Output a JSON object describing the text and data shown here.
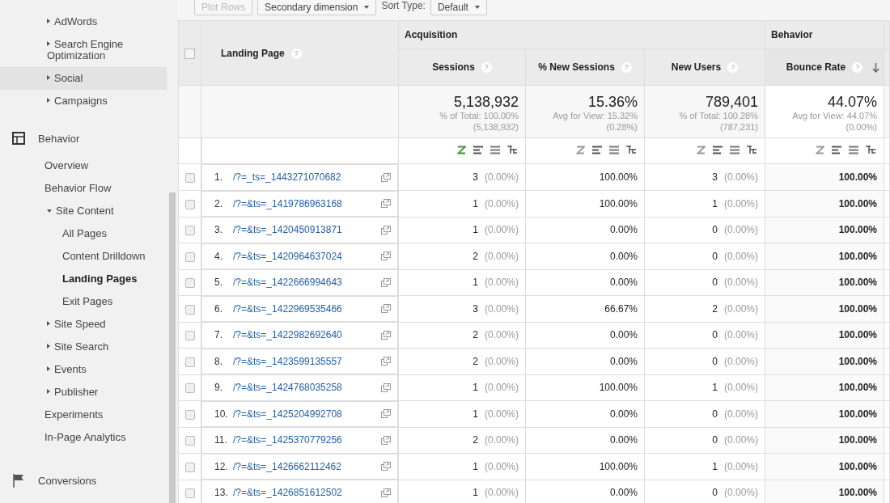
{
  "sidebar": {
    "items": [
      {
        "label": "AdWords",
        "kind": "group",
        "expanded": false,
        "selected": false
      },
      {
        "label": "Search Engine Optimization",
        "kind": "group",
        "expanded": false,
        "selected": false
      },
      {
        "label": "Social",
        "kind": "group",
        "expanded": false,
        "selected": true
      },
      {
        "label": "Campaigns",
        "kind": "group",
        "expanded": false,
        "selected": false
      },
      {
        "label": "Behavior",
        "kind": "grid-section",
        "children": [
          {
            "label": "Overview",
            "kind": "link",
            "selected": false
          },
          {
            "label": "Behavior Flow",
            "kind": "link",
            "selected": false
          },
          {
            "label": "Site Content",
            "kind": "group",
            "expanded": true,
            "selected": false,
            "children": [
              {
                "label": "All Pages",
                "selected": false
              },
              {
                "label": "Content Drilldown",
                "selected": false
              },
              {
                "label": "Landing Pages",
                "selected": true
              },
              {
                "label": "Exit Pages",
                "selected": false
              }
            ]
          },
          {
            "label": "Site Speed",
            "kind": "group",
            "expanded": false,
            "selected": false
          },
          {
            "label": "Site Search",
            "kind": "group",
            "expanded": false,
            "selected": false
          },
          {
            "label": "Events",
            "kind": "group",
            "expanded": false,
            "selected": false
          },
          {
            "label": "Publisher",
            "kind": "group",
            "expanded": false,
            "selected": false
          },
          {
            "label": "Experiments",
            "kind": "link",
            "selected": false
          },
          {
            "label": "In-Page Analytics",
            "kind": "link",
            "selected": false
          }
        ]
      },
      {
        "label": "Conversions",
        "kind": "flag-section"
      }
    ]
  },
  "toolbar": {
    "plot_rows": {
      "label": "Plot Rows",
      "disabled": true
    },
    "secondary_dimension": "Secondary dimension",
    "sort_type_label": "Sort Type:",
    "sort_type": "Default"
  },
  "table": {
    "all_checked": false,
    "groups": [
      {
        "label": "Acquisition"
      },
      {
        "label": "Behavior"
      }
    ],
    "dimension": {
      "label": "Landing Page",
      "help": "?"
    },
    "columns": [
      {
        "label": "Sessions",
        "help": "?",
        "sorted": false,
        "view_selected": true,
        "total": "5,138,932",
        "total_note": "% of Total: 100.00%",
        "total_base": "(5,138,932)"
      },
      {
        "label": "% New Sessions",
        "help": "?",
        "sorted": false,
        "view_selected": false,
        "total": "15.36%",
        "total_note": "Avg for View: 15.32%",
        "total_base": "(0.28%)"
      },
      {
        "label": "New Users",
        "help": "?",
        "sorted": false,
        "view_selected": false,
        "total": "789,401",
        "total_note": "% of Total: 100.28%",
        "total_base": "(787,231)"
      },
      {
        "label": "Bounce Rate",
        "help": "?",
        "sorted": true,
        "view_selected": false,
        "total": "44.07%",
        "total_note": "Avg for View: 44.07%",
        "total_base": "(0.00%)"
      }
    ],
    "rows": [
      {
        "checked": false,
        "index": "1.",
        "page": "/?=_ts=_1443271070682",
        "sessions": "3",
        "sessions_share": "(0.00%)",
        "new_sessions": "100.00%",
        "new_users": "3",
        "new_users_share": "(0.00%)",
        "bounce_rate": "100.00%"
      },
      {
        "checked": false,
        "index": "2.",
        "page": "/?=&ts=_1419786963168",
        "sessions": "1",
        "sessions_share": "(0.00%)",
        "new_sessions": "100.00%",
        "new_users": "1",
        "new_users_share": "(0.00%)",
        "bounce_rate": "100.00%"
      },
      {
        "checked": false,
        "index": "3.",
        "page": "/?=&ts=_1420450913871",
        "sessions": "1",
        "sessions_share": "(0.00%)",
        "new_sessions": "0.00%",
        "new_users": "0",
        "new_users_share": "(0.00%)",
        "bounce_rate": "100.00%"
      },
      {
        "checked": false,
        "index": "4.",
        "page": "/?=&ts=_1420964637024",
        "sessions": "2",
        "sessions_share": "(0.00%)",
        "new_sessions": "0.00%",
        "new_users": "0",
        "new_users_share": "(0.00%)",
        "bounce_rate": "100.00%"
      },
      {
        "checked": false,
        "index": "5.",
        "page": "/?=&ts=_1422666994643",
        "sessions": "1",
        "sessions_share": "(0.00%)",
        "new_sessions": "0.00%",
        "new_users": "0",
        "new_users_share": "(0.00%)",
        "bounce_rate": "100.00%"
      },
      {
        "checked": false,
        "index": "6.",
        "page": "/?=&ts=_1422969535466",
        "sessions": "3",
        "sessions_share": "(0.00%)",
        "new_sessions": "66.67%",
        "new_users": "2",
        "new_users_share": "(0.00%)",
        "bounce_rate": "100.00%"
      },
      {
        "checked": false,
        "index": "7.",
        "page": "/?=&ts=_1422982692640",
        "sessions": "2",
        "sessions_share": "(0.00%)",
        "new_sessions": "0.00%",
        "new_users": "0",
        "new_users_share": "(0.00%)",
        "bounce_rate": "100.00%"
      },
      {
        "checked": false,
        "index": "8.",
        "page": "/?=&ts=_1423599135557",
        "sessions": "2",
        "sessions_share": "(0.00%)",
        "new_sessions": "0.00%",
        "new_users": "0",
        "new_users_share": "(0.00%)",
        "bounce_rate": "100.00%"
      },
      {
        "checked": false,
        "index": "9.",
        "page": "/?=&ts=_1424768035258",
        "sessions": "1",
        "sessions_share": "(0.00%)",
        "new_sessions": "100.00%",
        "new_users": "1",
        "new_users_share": "(0.00%)",
        "bounce_rate": "100.00%"
      },
      {
        "checked": false,
        "index": "10.",
        "page": "/?=&ts=_1425204992708",
        "sessions": "1",
        "sessions_share": "(0.00%)",
        "new_sessions": "0.00%",
        "new_users": "0",
        "new_users_share": "(0.00%)",
        "bounce_rate": "100.00%"
      },
      {
        "checked": false,
        "index": "11.",
        "page": "/?=&ts=_1425370779256",
        "sessions": "2",
        "sessions_share": "(0.00%)",
        "new_sessions": "0.00%",
        "new_users": "0",
        "new_users_share": "(0.00%)",
        "bounce_rate": "100.00%"
      },
      {
        "checked": false,
        "index": "12.",
        "page": "/?=&ts=_1426662112462",
        "sessions": "1",
        "sessions_share": "(0.00%)",
        "new_sessions": "100.00%",
        "new_users": "1",
        "new_users_share": "(0.00%)",
        "bounce_rate": "100.00%"
      },
      {
        "checked": false,
        "index": "13.",
        "page": "/?=&ts=_1426851612502",
        "sessions": "1",
        "sessions_share": "(0.00%)",
        "new_sessions": "0.00%",
        "new_users": "0",
        "new_users_share": "(0.00%)",
        "bounce_rate": "100.00%"
      }
    ]
  }
}
